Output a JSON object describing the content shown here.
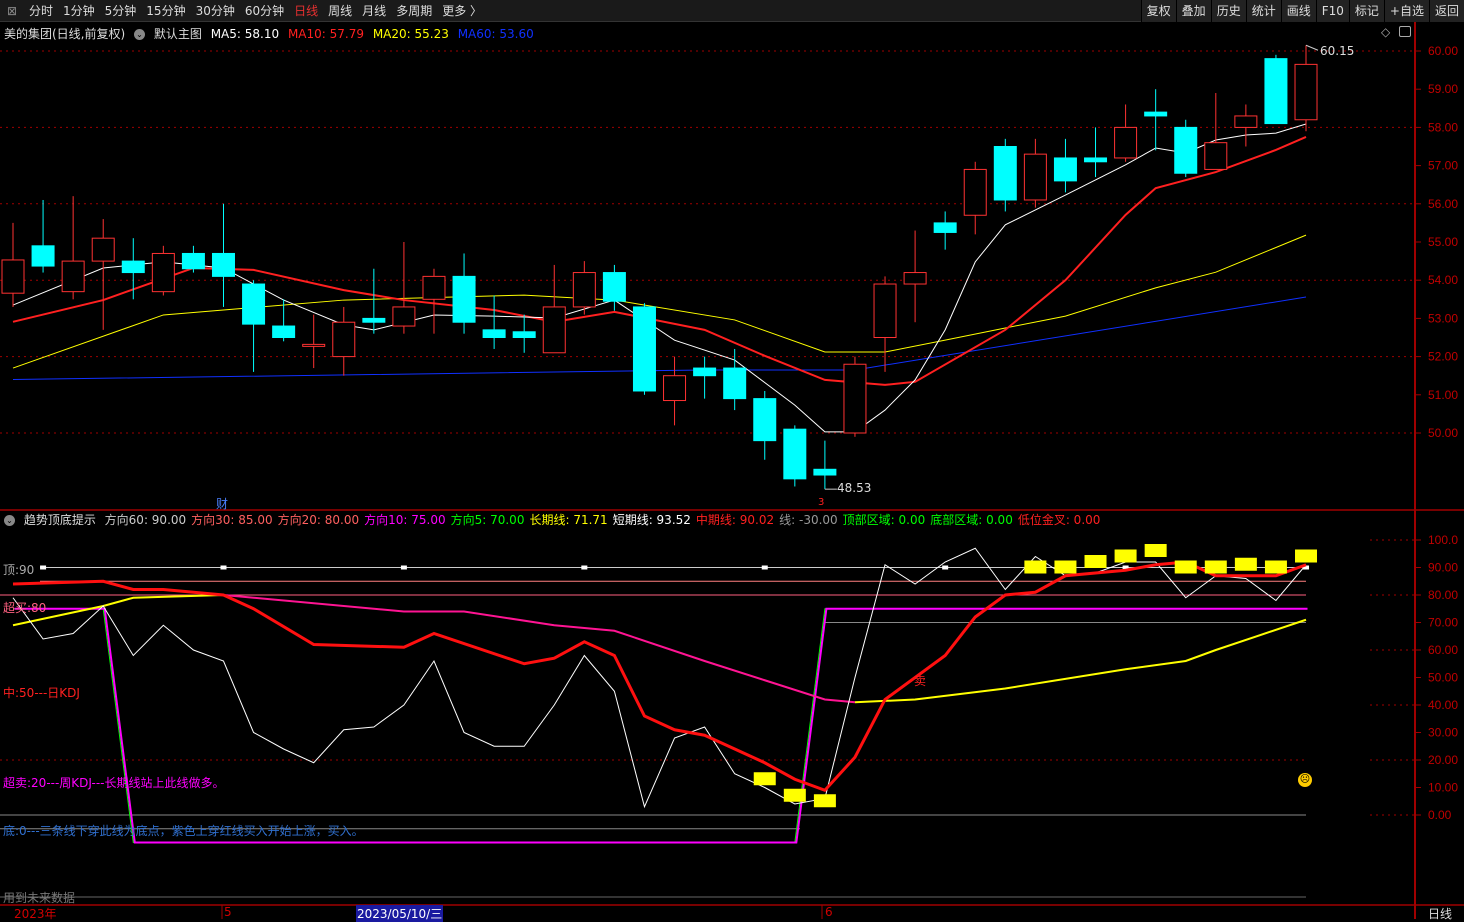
{
  "toolbar": {
    "tabs": [
      "分时",
      "1分钟",
      "5分钟",
      "15分钟",
      "30分钟",
      "60分钟",
      "日线",
      "周线",
      "月线",
      "多周期",
      "更多 〉"
    ],
    "active": "日线",
    "right_buttons": [
      "复权",
      "叠加",
      "历史",
      "统计",
      "画线",
      "F10",
      "标记",
      "+自选",
      "返回"
    ]
  },
  "main_header": {
    "title": "美的集团(日线,前复权)",
    "template": "默认主图",
    "ma5": "MA5: 58.10",
    "ma10": "MA10: 57.79",
    "ma20": "MA20: 55.23",
    "ma60": "MA60: 53.60"
  },
  "colors": {
    "up": "#ff3232",
    "down": "#00ffff",
    "ma5": "#ffffff",
    "ma10": "#ff2020",
    "ma20": "#ffff00",
    "ma60": "#1030ff",
    "axis": "#a00000"
  },
  "price_axis": [
    "60.00",
    "59.00",
    "58.00",
    "57.00",
    "56.00",
    "55.00",
    "54.00",
    "53.00",
    "52.00",
    "51.00",
    "50.00"
  ],
  "annotations": {
    "high": "60.15",
    "low": "48.53",
    "cai": "财",
    "three": "3",
    "sell": "卖"
  },
  "candles": [
    [
      53.66,
      54.53,
      55.5,
      53.3
    ],
    [
      54.9,
      54.37,
      56.1,
      54.2
    ],
    [
      53.7,
      54.5,
      56.2,
      53.5
    ],
    [
      54.5,
      55.1,
      55.6,
      52.7
    ],
    [
      54.5,
      54.2,
      55.1,
      53.5
    ],
    [
      53.7,
      54.7,
      54.9,
      53.6
    ],
    [
      54.7,
      54.3,
      54.9,
      54.2
    ],
    [
      54.7,
      54.1,
      56,
      53.3
    ],
    [
      53.9,
      52.85,
      54,
      51.6
    ],
    [
      52.8,
      52.5,
      53.5,
      52.4
    ],
    [
      52.3,
      52.32,
      53.1,
      51.7
    ],
    [
      52.0,
      52.9,
      53.3,
      51.5
    ],
    [
      53.0,
      52.9,
      54.3,
      52.6
    ],
    [
      52.8,
      53.3,
      55.0,
      52.6
    ],
    [
      53.5,
      54.1,
      54.3,
      52.6
    ],
    [
      54.1,
      52.9,
      54.7,
      52.6
    ],
    [
      52.7,
      52.5,
      53.6,
      52.2
    ],
    [
      52.65,
      52.5,
      53.1,
      52.1
    ],
    [
      52.1,
      53.3,
      54.4,
      52.1
    ],
    [
      53.3,
      54.2,
      54.5,
      53.1
    ],
    [
      54.2,
      53.45,
      54.4,
      53.2
    ],
    [
      53.3,
      51.1,
      53.4,
      51.0
    ],
    [
      50.85,
      51.5,
      52.0,
      50.2
    ],
    [
      51.7,
      51.5,
      52.0,
      50.9
    ],
    [
      51.7,
      50.9,
      52.2,
      50.6
    ],
    [
      50.9,
      49.8,
      51.1,
      49.3
    ],
    [
      50.1,
      48.8,
      50.2,
      48.6
    ],
    [
      49.05,
      48.9,
      49.8,
      48.53
    ],
    [
      50.0,
      51.8,
      52.0,
      49.9
    ],
    [
      52.5,
      53.9,
      54.1,
      51.6
    ],
    [
      53.9,
      54.2,
      55.3,
      52.9
    ],
    [
      55.5,
      55.25,
      55.8,
      54.8
    ],
    [
      55.7,
      56.9,
      57.1,
      55.2
    ],
    [
      57.5,
      56.1,
      57.7,
      55.8
    ],
    [
      56.1,
      57.3,
      57.7,
      55.9
    ],
    [
      57.2,
      56.6,
      57.7,
      56.3
    ],
    [
      57.2,
      57.1,
      58.0,
      56.7
    ],
    [
      57.2,
      58.0,
      58.6,
      57.1
    ],
    [
      58.4,
      58.3,
      59.0,
      57.4
    ],
    [
      58.0,
      56.8,
      58.2,
      56.7
    ],
    [
      56.9,
      57.6,
      58.9,
      56.9
    ],
    [
      58.0,
      58.3,
      58.6,
      57.5
    ],
    [
      59.8,
      58.1,
      59.9,
      58.1
    ],
    [
      58.2,
      59.65,
      60.15,
      57.9
    ]
  ],
  "ma_lines": {
    "ma5": [
      [
        0,
        53.35
      ],
      [
        3,
        54.32
      ],
      [
        5,
        54.48
      ],
      [
        7,
        54.32
      ],
      [
        9,
        53.48
      ],
      [
        11,
        52.83
      ],
      [
        12,
        52.7
      ],
      [
        14,
        53.09
      ],
      [
        16,
        53.06
      ],
      [
        18,
        53.01
      ],
      [
        20,
        53.48
      ],
      [
        22,
        52.43
      ],
      [
        24,
        51.91
      ],
      [
        26,
        50.73
      ],
      [
        27,
        50.03
      ],
      [
        28,
        50.03
      ],
      [
        29,
        50.6
      ],
      [
        30,
        51.39
      ],
      [
        31,
        52.7
      ],
      [
        32,
        54.48
      ],
      [
        33,
        55.45
      ],
      [
        35,
        56.23
      ],
      [
        37,
        57.02
      ],
      [
        38,
        57.46
      ],
      [
        39,
        57.33
      ],
      [
        40,
        57.67
      ],
      [
        41,
        57.8
      ],
      [
        42,
        57.85
      ],
      [
        43,
        58.09
      ]
    ],
    "ma10": [
      [
        0,
        52.91
      ],
      [
        3,
        53.48
      ],
      [
        6,
        54.32
      ],
      [
        8,
        54.27
      ],
      [
        11,
        53.74
      ],
      [
        13,
        53.48
      ],
      [
        16,
        53.22
      ],
      [
        18,
        52.91
      ],
      [
        20,
        53.17
      ],
      [
        23,
        52.7
      ],
      [
        25,
        52.02
      ],
      [
        27,
        51.39
      ],
      [
        29,
        51.26
      ],
      [
        30,
        51.34
      ],
      [
        33,
        52.7
      ],
      [
        35,
        54.0
      ],
      [
        37,
        55.71
      ],
      [
        38,
        56.41
      ],
      [
        40,
        56.83
      ],
      [
        42,
        57.41
      ],
      [
        43,
        57.75
      ]
    ],
    "ma20": [
      [
        0,
        51.7
      ],
      [
        5,
        53.09
      ],
      [
        11,
        53.48
      ],
      [
        17,
        53.61
      ],
      [
        20,
        53.48
      ],
      [
        24,
        52.96
      ],
      [
        27,
        52.12
      ],
      [
        29,
        52.12
      ],
      [
        31,
        52.43
      ],
      [
        33,
        52.75
      ],
      [
        35,
        53.06
      ],
      [
        38,
        53.8
      ],
      [
        40,
        54.21
      ],
      [
        43,
        55.18
      ]
    ],
    "ma60": [
      [
        0,
        51.4
      ],
      [
        23,
        51.65
      ],
      [
        28,
        51.65
      ],
      [
        43,
        53.56
      ]
    ]
  },
  "indicator": {
    "name": "趋势顶底提示",
    "values": [
      {
        "t": "方向60: 90.00",
        "c": "#cccccc"
      },
      {
        "t": "方向30: 85.00",
        "c": "#ff6060"
      },
      {
        "t": "方向20: 80.00",
        "c": "#ff6060"
      },
      {
        "t": "方向10: 75.00",
        "c": "#ff00ff"
      },
      {
        "t": "方向5: 70.00",
        "c": "#00ff00"
      },
      {
        "t": "长期线: 71.71",
        "c": "#ffff00"
      },
      {
        "t": "短期线: 93.52",
        "c": "#ffffff"
      },
      {
        "t": "中期线: 90.02",
        "c": "#ff2020"
      },
      {
        "t": "线: -30.00",
        "c": "#999999"
      },
      {
        "t": "顶部区域: 0.00",
        "c": "#00ff00"
      },
      {
        "t": "底部区域: 0.00",
        "c": "#00ff00"
      },
      {
        "t": "低位金叉: 0.00",
        "c": "#ff2020"
      }
    ],
    "axis": [
      "100.0",
      "90.00",
      "80.00",
      "70.00",
      "60.00",
      "50.00",
      "40.00",
      "30.00",
      "20.00",
      "10.00",
      "0.00"
    ],
    "labels": {
      "top": "顶:90",
      "overbought": "超买:80",
      "mid": "中:50---日KDJ",
      "oversold": "超卖:20---周KDJ---长期线站上此线做多。",
      "bottom": "底:0---三条线下穿此线为底点，紫色上穿红线买入开始上涨，买入。",
      "future": "用到未来数据"
    },
    "mid_line": [
      [
        0,
        84
      ],
      [
        3,
        85
      ],
      [
        4,
        82
      ],
      [
        5,
        82
      ],
      [
        7,
        80
      ],
      [
        8,
        75
      ],
      [
        10,
        62
      ],
      [
        13,
        61
      ],
      [
        14,
        66
      ],
      [
        17,
        55
      ],
      [
        18,
        57
      ],
      [
        19,
        63
      ],
      [
        20,
        58
      ],
      [
        21,
        36
      ],
      [
        22,
        31
      ],
      [
        23,
        29
      ],
      [
        25,
        19
      ],
      [
        26,
        13
      ],
      [
        27,
        9
      ],
      [
        28,
        21
      ],
      [
        29,
        42
      ],
      [
        31,
        58
      ],
      [
        32,
        72
      ],
      [
        33,
        80
      ],
      [
        34,
        81
      ],
      [
        35,
        87
      ],
      [
        37,
        89
      ],
      [
        38,
        91
      ],
      [
        39,
        92
      ],
      [
        40,
        87
      ],
      [
        42,
        87
      ],
      [
        43,
        91
      ]
    ],
    "short_line": [
      [
        0,
        79
      ],
      [
        1,
        64
      ],
      [
        2,
        66
      ],
      [
        3,
        76
      ],
      [
        4,
        58
      ],
      [
        5,
        69
      ],
      [
        6,
        60
      ],
      [
        7,
        56
      ],
      [
        8,
        30
      ],
      [
        9,
        24
      ],
      [
        10,
        19
      ],
      [
        11,
        31
      ],
      [
        12,
        32
      ],
      [
        13,
        40
      ],
      [
        14,
        56
      ],
      [
        15,
        30
      ],
      [
        16,
        25
      ],
      [
        17,
        25
      ],
      [
        18,
        40
      ],
      [
        19,
        58
      ],
      [
        20,
        45
      ],
      [
        21,
        3
      ],
      [
        22,
        28
      ],
      [
        23,
        32
      ],
      [
        24,
        15
      ],
      [
        25,
        10
      ],
      [
        26,
        4
      ],
      [
        27,
        6
      ],
      [
        28,
        50
      ],
      [
        29,
        91
      ],
      [
        30,
        84
      ],
      [
        31,
        92
      ],
      [
        32,
        97
      ],
      [
        33,
        82
      ],
      [
        34,
        94
      ],
      [
        35,
        87
      ],
      [
        36,
        88
      ],
      [
        37,
        92
      ],
      [
        38,
        92
      ],
      [
        39,
        79
      ],
      [
        40,
        87
      ],
      [
        41,
        86
      ],
      [
        42,
        78
      ],
      [
        43,
        91
      ]
    ],
    "long_line_a": [
      [
        0,
        69
      ],
      [
        3,
        76
      ],
      [
        4,
        79
      ],
      [
        7,
        80
      ]
    ],
    "long_line_pink": [
      [
        7,
        80
      ],
      [
        13,
        74
      ],
      [
        15,
        74
      ],
      [
        18,
        69
      ],
      [
        20,
        67
      ],
      [
        23,
        56
      ],
      [
        25,
        49
      ],
      [
        27,
        42
      ],
      [
        28,
        41
      ]
    ],
    "long_line_b": [
      [
        28,
        41
      ],
      [
        30,
        42
      ],
      [
        33,
        46
      ],
      [
        37,
        53
      ],
      [
        39,
        56
      ],
      [
        40,
        60
      ],
      [
        43,
        71
      ]
    ],
    "step_line": [
      [
        0,
        75
      ],
      [
        3,
        75
      ],
      [
        4,
        -10
      ],
      [
        26,
        -10
      ],
      [
        27,
        75
      ],
      [
        43,
        75
      ]
    ],
    "signals": [
      [
        25,
        13
      ],
      [
        26,
        7
      ],
      [
        27,
        5
      ],
      [
        34,
        90
      ],
      [
        35,
        90
      ],
      [
        36,
        92
      ],
      [
        37,
        94
      ],
      [
        38,
        96
      ],
      [
        39,
        90
      ],
      [
        40,
        90
      ],
      [
        41,
        91
      ],
      [
        42,
        90
      ],
      [
        43,
        94
      ]
    ]
  },
  "time_axis": {
    "year": "2023年",
    "may": "5",
    "cursor": "2023/05/10/三",
    "june": "6",
    "period": "日线"
  }
}
